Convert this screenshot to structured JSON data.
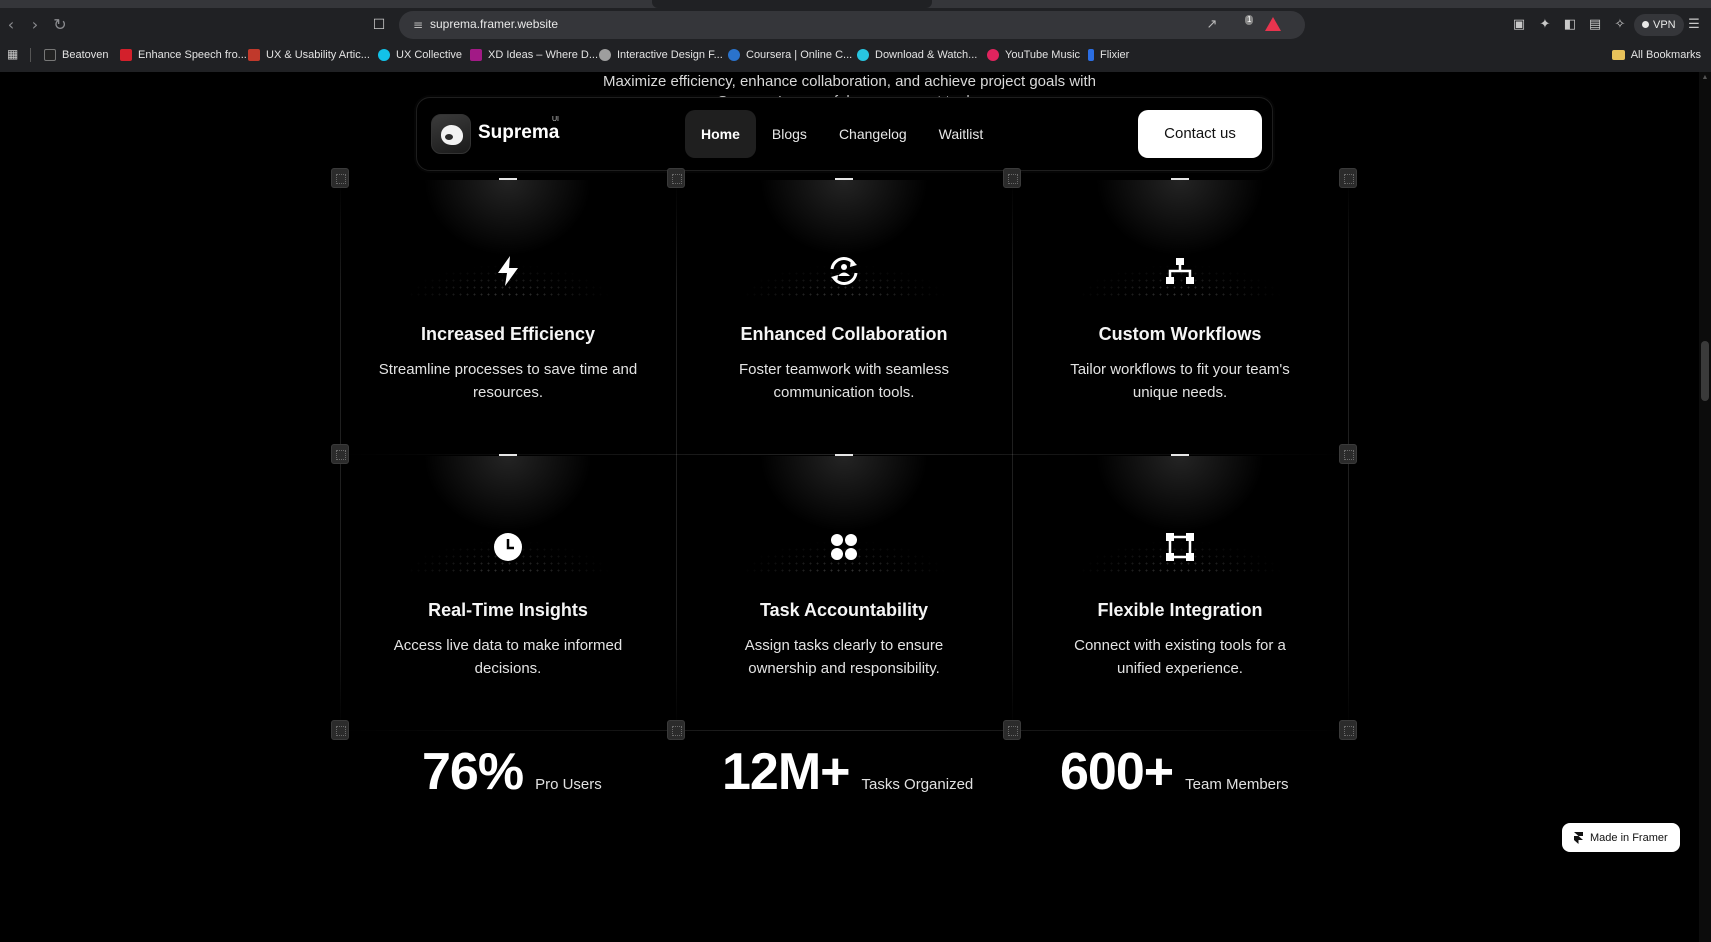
{
  "browser": {
    "url": "suprema.framer.website",
    "vpn_label": "VPN",
    "shield_count": "1",
    "bookmarks": [
      {
        "label": "Beatoven",
        "color": "#222222"
      },
      {
        "label": "Enhance Speech fro...",
        "color": "#d3202b"
      },
      {
        "label": "UX & Usability Artic...",
        "color": "#c0392b"
      },
      {
        "label": "UX Collective",
        "color": "#12c2e9"
      },
      {
        "label": "XD Ideas – Where D...",
        "color": "#a21a86"
      },
      {
        "label": "Interactive Design F...",
        "color": "#9e9e9e"
      },
      {
        "label": "Coursera | Online C...",
        "color": "#2a73cc"
      },
      {
        "label": "Download & Watch...",
        "color": "#28c5e0"
      },
      {
        "label": "YouTube Music",
        "color": "#e0245e"
      },
      {
        "label": "Flixier",
        "color": "#2b6ee3"
      }
    ],
    "all_bookmarks_label": "All Bookmarks"
  },
  "page": {
    "intro_line1": "Maximize efficiency, enhance collaboration, and achieve project goals with",
    "intro_line2": "Suprema's powerful management tools."
  },
  "navbar": {
    "brand": "Suprema",
    "brand_sup": "UI",
    "links": [
      {
        "label": "Home",
        "active": true
      },
      {
        "label": "Blogs",
        "active": false
      },
      {
        "label": "Changelog",
        "active": false
      },
      {
        "label": "Waitlist",
        "active": false
      }
    ],
    "cta": "Contact us"
  },
  "features": [
    {
      "icon": "lightning-icon",
      "title": "Increased Efficiency",
      "desc": "Streamline processes to save time and resources."
    },
    {
      "icon": "sync-collaboration-icon",
      "title": "Enhanced Collaboration",
      "desc": "Foster teamwork with seamless communication tools."
    },
    {
      "icon": "workflow-hierarchy-icon",
      "title": "Custom Workflows",
      "desc": "Tailor workflows to fit your team's unique needs."
    },
    {
      "icon": "clock-icon",
      "title": "Real-Time Insights",
      "desc": "Access live data to make informed decisions."
    },
    {
      "icon": "four-dots-icon",
      "title": "Task Accountability",
      "desc": "Assign tasks clearly to ensure ownership and responsibility."
    },
    {
      "icon": "integration-nodes-icon",
      "title": "Flexible Integration",
      "desc": "Connect with existing tools for a unified experience."
    }
  ],
  "stats": [
    {
      "value": "76%",
      "label": "Pro Users"
    },
    {
      "value": "12M+",
      "label": "Tasks Organized"
    },
    {
      "value": "600+",
      "label": "Team Members"
    }
  ],
  "badge": {
    "label": "Made in Framer"
  },
  "colors": {
    "background": "#000000",
    "text": "#ffffff",
    "cta_bg": "#ffffff",
    "nav_active_bg": "#1f1f1f"
  }
}
